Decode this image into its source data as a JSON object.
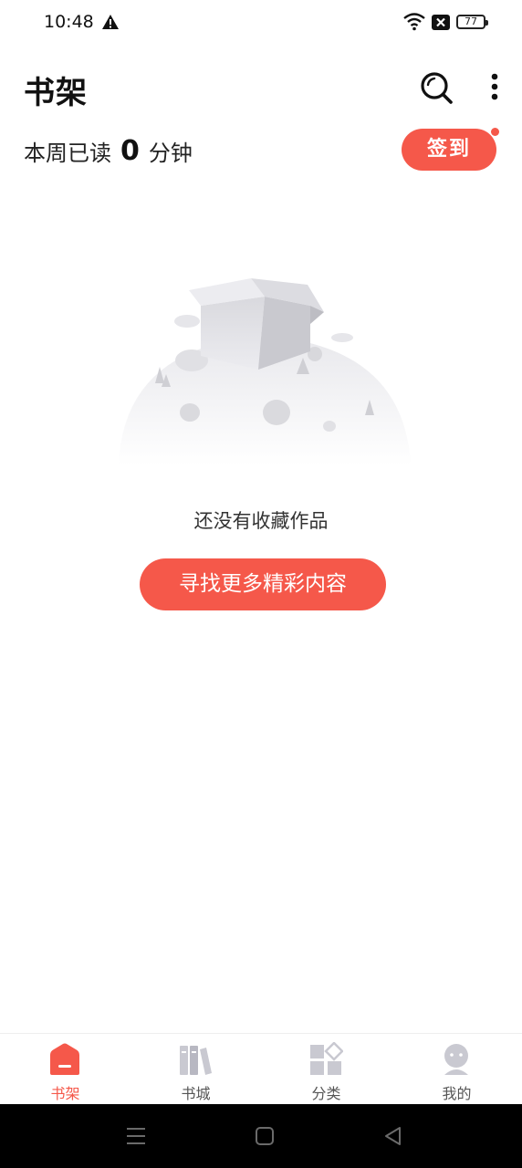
{
  "status_bar": {
    "time": "10:48",
    "battery": "77"
  },
  "header": {
    "title": "书架"
  },
  "weekly": {
    "label": "本周已读",
    "count": "0",
    "unit": "分钟"
  },
  "checkin": {
    "label": "签到"
  },
  "empty": {
    "message": "还没有收藏作品",
    "button": "寻找更多精彩内容"
  },
  "nav": {
    "items": [
      {
        "label": "书架",
        "icon": "bookshelf-icon",
        "active": true
      },
      {
        "label": "书城",
        "icon": "bookstore-icon",
        "active": false
      },
      {
        "label": "分类",
        "icon": "category-icon",
        "active": false
      },
      {
        "label": "我的",
        "icon": "profile-icon",
        "active": false
      }
    ]
  },
  "colors": {
    "accent": "#f5584a",
    "inactive_icon": "#c9c9d1"
  }
}
